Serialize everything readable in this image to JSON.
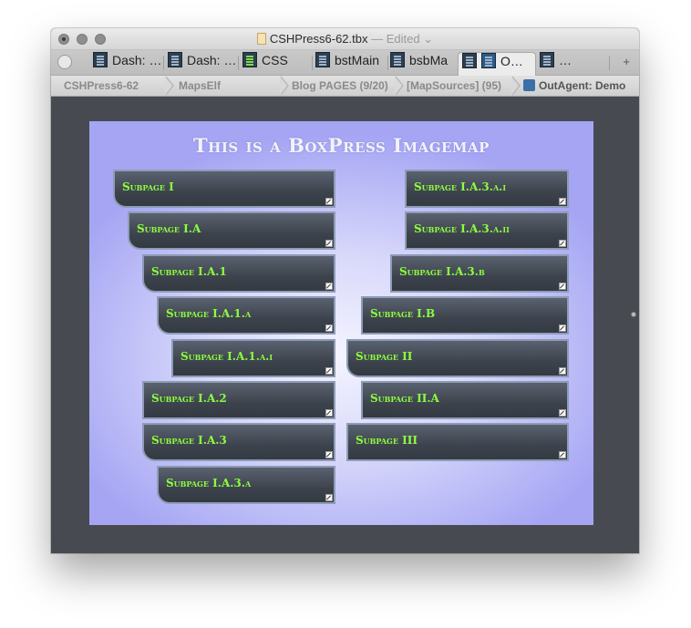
{
  "window": {
    "title": "CSHPress6-62.tbx",
    "title_status": "— Edited",
    "title_chevron": "⌄"
  },
  "tabs": [
    {
      "label": "Dash: …",
      "icon": "document-list-icon"
    },
    {
      "label": "Dash: …",
      "icon": "document-list-icon"
    },
    {
      "label": "CSS",
      "icon": "green-list-icon"
    },
    {
      "label": "bstMain",
      "icon": "document-list-icon"
    },
    {
      "label": "bsbMa",
      "icon": "document-list-icon"
    },
    {
      "label": "O…",
      "icon": "outline-icon",
      "active": true
    },
    {
      "label": "…",
      "icon": "document-list-icon"
    }
  ],
  "tab_plus": "+",
  "breadcrumbs": [
    "CSHPress6-62",
    "MapsElf",
    "Blog PAGES (9/20)",
    "[MapSources] (95)",
    "OutAgent: Demo"
  ],
  "imagemap": {
    "title": "This is a BoxPress Imagemap",
    "boxes": [
      {
        "label": "Subpage I"
      },
      {
        "label": "Subpage I.A"
      },
      {
        "label": "Subpage I.A.1"
      },
      {
        "label": "Subpage I.A.1.a"
      },
      {
        "label": "Subpage I.A.1.a.i"
      },
      {
        "label": "Subpage I.A.2"
      },
      {
        "label": "Subpage I.A.3"
      },
      {
        "label": "Subpage I.A.3.a"
      },
      {
        "label": "Subpage I.A.3.a.i"
      },
      {
        "label": "Subpage I.A.3.a.ii"
      },
      {
        "label": "Subpage I.A.3.b"
      },
      {
        "label": "Subpage I.B"
      },
      {
        "label": "Subpage II"
      },
      {
        "label": "Subpage II.A"
      },
      {
        "label": "Subpage III"
      }
    ]
  },
  "colors": {
    "box_text": "#8cff3e",
    "box_border": "#8e9cb6",
    "canvas_background": "#474b51"
  }
}
